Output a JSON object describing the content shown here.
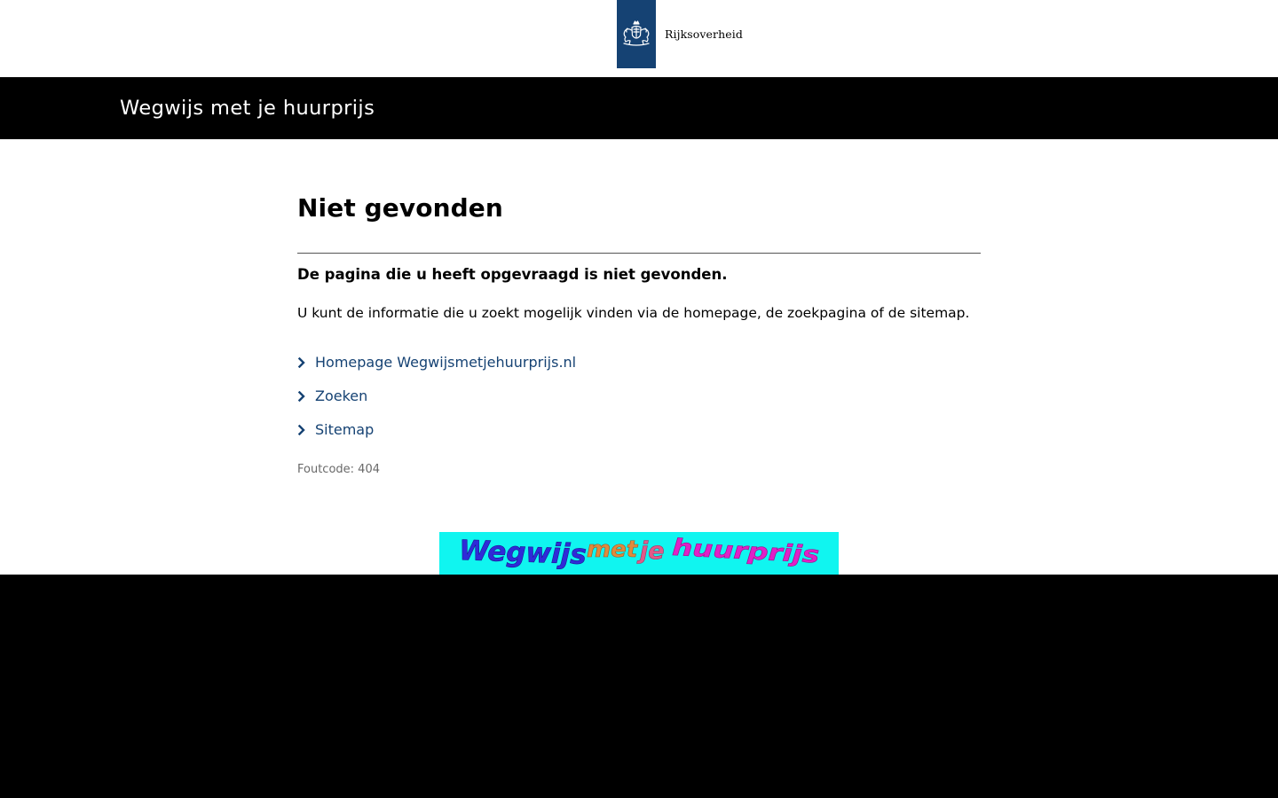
{
  "header": {
    "logo_text": "Rijksoverheid",
    "logo_bar_color": "#154273",
    "logo_icon": "coat-of-arms-icon"
  },
  "site_bar": {
    "title": "Wegwijs met je huurprijs"
  },
  "main": {
    "title": "Niet gevonden",
    "lead": "De pagina die u heeft opgevraagd is niet gevonden.",
    "body": "U kunt de informatie die u zoekt mogelijk vinden via de homepage, de zoekpagina of de sitemap.",
    "links": [
      {
        "label": "Homepage Wegwijsmetjehuurprijs.nl"
      },
      {
        "label": "Zoeken"
      },
      {
        "label": "Sitemap"
      }
    ],
    "link_icon": "chevron-right-icon",
    "link_color": "#154273",
    "error_code": "Foutcode: 404"
  },
  "banner": {
    "wordmark": [
      "Wegwijs",
      "met",
      "je",
      "huurprijs"
    ],
    "background": "#10f5f0",
    "word_colors": [
      "#2f2bd8",
      "#e08a3c",
      "#e05a8a",
      "#e020c8"
    ]
  },
  "footer": {
    "background": "#000000"
  }
}
